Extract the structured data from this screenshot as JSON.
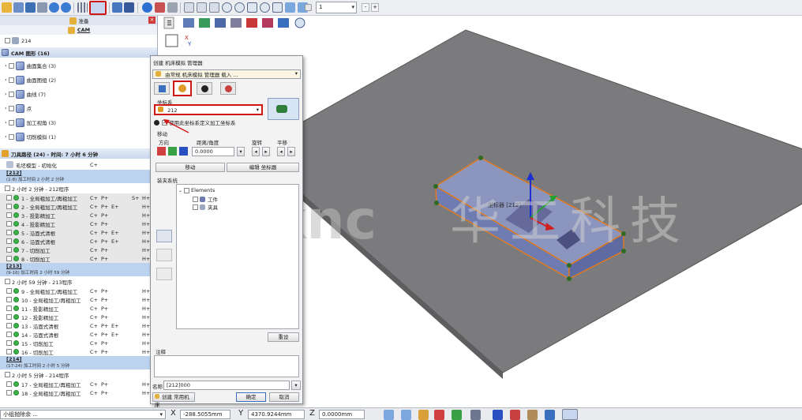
{
  "toolbar": {
    "combo_value": "1",
    "btn_minus": "-",
    "btn_plus": "+"
  },
  "tree": {
    "header_tab1": "准备",
    "header_tab2": "CAM",
    "root_item": "214",
    "cam_section": "CAM 图形 (16)",
    "cam_items": [
      {
        "label": "曲面集合 (3)"
      },
      {
        "label": "曲面图组 (2)"
      },
      {
        "label": "曲线 (7)"
      },
      {
        "label": "点"
      },
      {
        "label": "加工视角 (3)"
      },
      {
        "label": "切削模拟 (1)"
      }
    ],
    "toolpath_section": "刀具路径 (24) - 时间: 7 小时 6 分钟",
    "stock_row": {
      "label": "毛坯模型 - 初始化",
      "c": "C+"
    },
    "groups": [
      {
        "name": "[212]",
        "sub": "(1-8) 加工时间 2 小时 2 分钟",
        "time": "2 小时 2 分钟 - 212程序"
      },
      {
        "name": "[213]",
        "sub": "(9-16) 加工时间 2 小时 59 分钟",
        "time": "2 小时 59 分钟 - 213程序"
      },
      {
        "name": "[214]",
        "sub": "(17-24) 加工时间 2 小时 5 分钟",
        "time": "2 小时 5 分钟 - 214程序"
      }
    ],
    "ops": [
      {
        "label": "1 - 全局粗加工/再粗加工",
        "c": "C+",
        "p": "P+",
        "e": "",
        "s": "S+",
        "h": "H+"
      },
      {
        "label": "2 - 全局粗加工/再粗加工",
        "c": "C+",
        "p": "P+",
        "e": "E+",
        "s": "",
        "h": "H+"
      },
      {
        "label": "3 - 投影精加工",
        "c": "C+",
        "p": "P+",
        "e": "",
        "s": "",
        "h": "H+"
      },
      {
        "label": "4 - 投影精加工",
        "c": "C+",
        "p": "P+",
        "e": "",
        "s": "",
        "h": "H+"
      },
      {
        "label": "5 - 沿面式清根",
        "c": "C+",
        "p": "P+",
        "e": "E+",
        "s": "",
        "h": "H+"
      },
      {
        "label": "6 - 沿面式清根",
        "c": "C+",
        "p": "P+",
        "e": "E+",
        "s": "",
        "h": "H+"
      },
      {
        "label": "7 - 切削加工",
        "c": "C+",
        "p": "P+",
        "e": "",
        "s": "",
        "h": "H+"
      },
      {
        "label": "8 - 切削加工",
        "c": "C+",
        "p": "P+",
        "e": "",
        "s": "",
        "h": "H+"
      },
      {
        "label": "9 - 全局粗加工/再粗加工",
        "c": "C+",
        "p": "P+",
        "e": "",
        "s": "",
        "h": "H+"
      },
      {
        "label": "10 - 全局粗加工/再粗加工",
        "c": "C+",
        "p": "P+",
        "e": "",
        "s": "",
        "h": "H+"
      },
      {
        "label": "11 - 投影精加工",
        "c": "C+",
        "p": "P+",
        "e": "",
        "s": "",
        "h": "H+"
      },
      {
        "label": "12 - 投影精加工",
        "c": "C+",
        "p": "P+",
        "e": "",
        "s": "",
        "h": "H+"
      },
      {
        "label": "13 - 沿面式清根",
        "c": "C+",
        "p": "P+",
        "e": "E+",
        "s": "",
        "h": "H+"
      },
      {
        "label": "14 - 沿面式清根",
        "c": "C+",
        "p": "P+",
        "e": "E+",
        "s": "",
        "h": "H+"
      },
      {
        "label": "15 - 切削加工",
        "c": "C+",
        "p": "P+",
        "e": "",
        "s": "",
        "h": "H+"
      },
      {
        "label": "16 - 切削加工",
        "c": "C+",
        "p": "P+",
        "e": "",
        "s": "",
        "h": "H+"
      },
      {
        "label": "17 - 全局粗加工/再粗加工",
        "c": "C+",
        "p": "P+",
        "e": "",
        "s": "",
        "h": "H+"
      },
      {
        "label": "18 - 全局粗加工/再粗加工",
        "c": "C+",
        "p": "P+",
        "e": "",
        "s": "",
        "h": "H+"
      }
    ]
  },
  "dialog": {
    "title": "创建 机床模拟 管理器",
    "dropdown": "由常规 机床模拟 管理器 载入 ...",
    "coord_label": "坐标系",
    "coord_value": "212",
    "checkbox_label": "使用此坐标系定义加工坐标系",
    "move_label": "移动",
    "dir_label": "方向",
    "dist_label": "距离/角度",
    "rot_label": "旋转",
    "trans_label": "平移",
    "dist_value": "0.0000",
    "move_button": "移动",
    "edit_button": "编辑 坐标器",
    "clamp_label": "装夹系统",
    "tree_elements": "Elements",
    "tree_work": "工件",
    "tree_fixture": "夹具",
    "reset_button": "重设",
    "note_label": "注释",
    "name_label": "名称",
    "name_value": "[212]000",
    "create_machine": "创建 常用机床",
    "ok_button": "确定",
    "cancel_button": "取消"
  },
  "viewport": {
    "watermark_en": "worknc",
    "watermark_cn": "华工科技",
    "label_3d": "坐标器 [212]"
  },
  "status": {
    "left_text": "小组抛除余 ...",
    "x_label": "X",
    "x_value": "-288.5055mm",
    "y_label": "Y",
    "y_value": "4370.9244mm",
    "z_label": "Z",
    "z_value": "0.0000mm"
  }
}
